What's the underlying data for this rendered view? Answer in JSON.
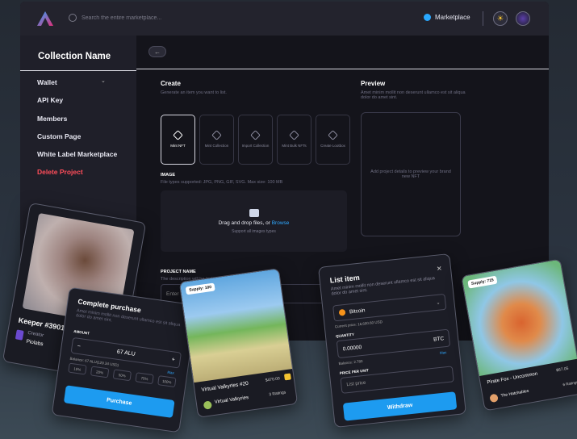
{
  "topbar": {
    "search_placeholder": "Search the entire marketplace...",
    "marketplace_label": "Marketplace"
  },
  "sidebar": {
    "collection_name": "Collection Name",
    "items": [
      {
        "label": "Wallet"
      },
      {
        "label": "API Key"
      },
      {
        "label": "Members"
      },
      {
        "label": "Custom Page"
      },
      {
        "label": "White Label Marketplace"
      },
      {
        "label": "Delete Project"
      }
    ]
  },
  "create": {
    "title": "Create",
    "subtitle": "Generate an item you want to list.",
    "options": [
      {
        "label": "Mint NFT"
      },
      {
        "label": "Mint Collection"
      },
      {
        "label": "Import Collection"
      },
      {
        "label": "Mint Bulk NFTs"
      },
      {
        "label": "Create Lootbox"
      }
    ],
    "image_label": "IMAGE",
    "image_sub": "File types supported: JPG, PNG, GIF, SVG. Max size: 100 MB",
    "drop_text": "Drag and drop files, or ",
    "browse": "Browse",
    "drop_sub": "Support all images types",
    "project_name_label": "PROJECT NAME",
    "project_name_sub": "The description will be include on the item's detail page",
    "project_name_placeholder": "Enter Name"
  },
  "preview": {
    "title": "Preview",
    "subtitle": "Amet minim mollit non deserunt ullamco est sit aliqua dolor do amet sint.",
    "empty_text": "Add project details to preview your brand new NFT"
  },
  "keeper_card": {
    "name": "Keeper #3901",
    "creator_label": "Creator",
    "org": "Piolabs"
  },
  "purchase": {
    "title": "Complete purchase",
    "desc": "Amet minim mollit non deserunt ullamco est sit aliqua dolor do amet sint.",
    "amount_label": "AMOUNT",
    "amount_value": "67 ALU",
    "balance": "Balance: 67 ALU(129.34 USD)",
    "max": "Max",
    "percents": [
      "10%",
      "20%",
      "50%",
      "75%",
      "100%"
    ],
    "button": "Purchase"
  },
  "vv_card": {
    "supply": "Supply: 100",
    "name": "Virtual Valkyries #20",
    "price": "$470.00",
    "org": "Virtual Valkyries",
    "ratings": "3 Ratings"
  },
  "list_item": {
    "title": "List item",
    "desc": "Amet minim mollit non deserunt ullamco est sit aliqua dolor do amet sint.",
    "currency": "Bitcoin",
    "current_price": "Current price: 16,600.60 USD",
    "quantity_label": "QUANTITY",
    "quantity_value": "0.00000",
    "quantity_unit": "BTC",
    "balance": "Balance: 2.780",
    "max": "Max",
    "price_label": "PRICE PER UNIT",
    "price_placeholder": "List price",
    "button": "Withdraw"
  },
  "pf_card": {
    "supply": "Supply: 715",
    "name": "Pirate Fox - Uncommon",
    "price": "$67.05",
    "org": "The Hatchables",
    "ratings": "6 Ratings"
  }
}
